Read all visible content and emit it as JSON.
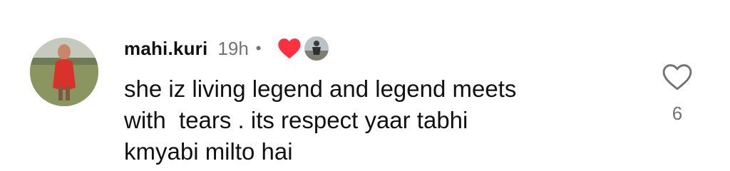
{
  "comment": {
    "username": "mahi.kuri",
    "time_ago": "19h",
    "separator": "•",
    "text": "she iz living legend and legend meets\nwith  tears . its respect yaar tabhi\nkmyabi milto hai",
    "like_count": "6",
    "icons": {
      "creator_heart": "heart-filled-icon",
      "liker": "liker-avatar",
      "like": "heart-outline-icon"
    }
  },
  "colors": {
    "text": "#111111",
    "secondary": "#737373",
    "heart": "#ff3040"
  }
}
